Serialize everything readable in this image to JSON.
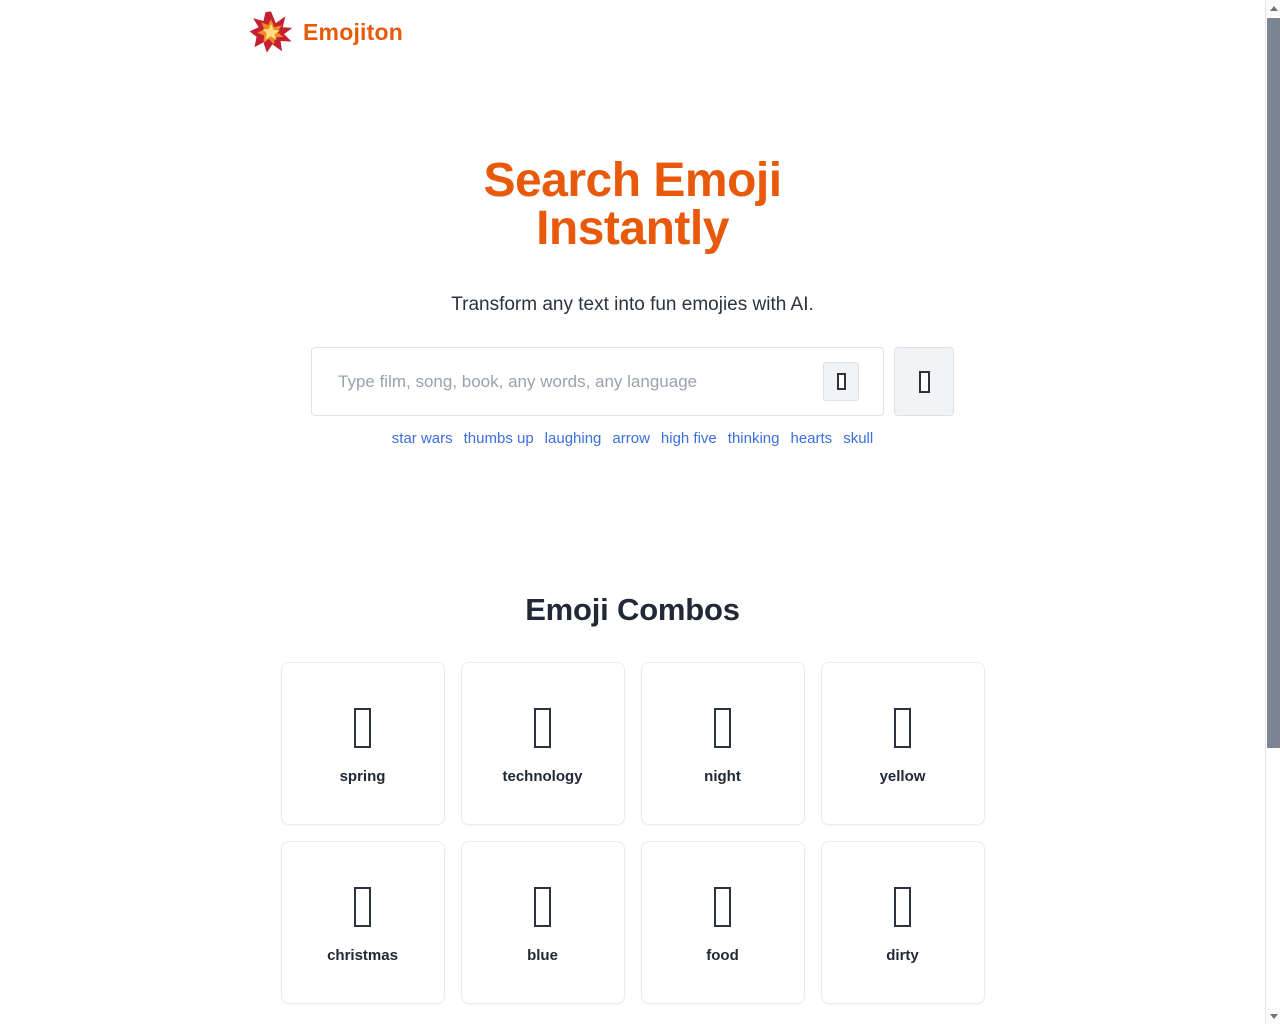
{
  "header": {
    "brand_name": "Emojiton",
    "logo_icon": "collision-emoji-icon"
  },
  "hero": {
    "title_line1": "Search Emoji",
    "title_line2": "Instantly",
    "subtitle": "Transform any text into fun emojies with AI.",
    "title_color": "#e8590c"
  },
  "search": {
    "placeholder": "Type film, song, book, any words, any language",
    "value": "",
    "inline_button_icon": "microphone-icon",
    "submit_button_icon": "search-icon"
  },
  "suggestions": {
    "items": [
      {
        "label": "star wars"
      },
      {
        "label": "thumbs up"
      },
      {
        "label": "laughing"
      },
      {
        "label": "arrow"
      },
      {
        "label": "high five"
      },
      {
        "label": "thinking"
      },
      {
        "label": "hearts"
      },
      {
        "label": "skull"
      }
    ],
    "link_color": "#3b6fe0"
  },
  "combos": {
    "title": "Emoji Combos",
    "cards": [
      {
        "label": "spring",
        "emoji_icon": "missing-glyph-icon"
      },
      {
        "label": "technology",
        "emoji_icon": "missing-glyph-icon"
      },
      {
        "label": "night",
        "emoji_icon": "missing-glyph-icon"
      },
      {
        "label": "yellow",
        "emoji_icon": "missing-glyph-icon"
      },
      {
        "label": "christmas",
        "emoji_icon": "missing-glyph-icon"
      },
      {
        "label": "blue",
        "emoji_icon": "missing-glyph-icon"
      },
      {
        "label": "food",
        "emoji_icon": "missing-glyph-icon"
      },
      {
        "label": "dirty",
        "emoji_icon": "missing-glyph-icon"
      }
    ]
  },
  "scrollbar": {
    "up_icon": "scroll-up-arrow-icon",
    "down_icon": "scroll-down-arrow-icon"
  }
}
